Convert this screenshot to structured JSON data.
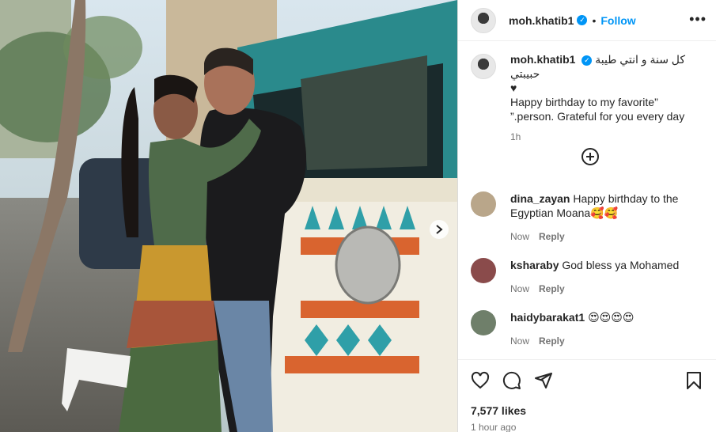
{
  "post": {
    "username": "moh.khatib1",
    "verified_badge": "✓",
    "dot": "•",
    "follow_label": "Follow",
    "more_label": "•••",
    "caption_user": "moh.khatib1",
    "caption_line1": "كل سنة و انتي طيبة حبيبتي",
    "caption_heart": "♥",
    "caption_line2": "Happy birthday to my favorite”",
    "caption_line3": "”.person. Grateful for you every day",
    "caption_time": "1h"
  },
  "comments": [
    {
      "user": "dina_zayan",
      "text": "Happy birthday to the Egyptian Moana🥰🥰",
      "time": "Now",
      "reply": "Reply",
      "avatar_color": "#b9a68a"
    },
    {
      "user": "ksharaby",
      "text": "God bless ya Mohamed",
      "time": "Now",
      "reply": "Reply",
      "avatar_color": "#8a4b4b"
    },
    {
      "user": "haidybarakat1",
      "text": "😍😍😍😍",
      "time": "Now",
      "reply": "Reply",
      "avatar_color": "#6f7f6a"
    }
  ],
  "footer": {
    "likes": "7,577 likes",
    "time_ago": "1 hour ago"
  },
  "icons": {
    "next": "chevron-right-icon",
    "like": "heart-icon",
    "comment": "comment-icon",
    "share": "share-icon",
    "save": "bookmark-icon",
    "add": "add-circle-icon"
  },
  "colors": {
    "accent": "#0095f6",
    "secondary_text": "#737373",
    "van_teal": "#2a8a8c"
  }
}
